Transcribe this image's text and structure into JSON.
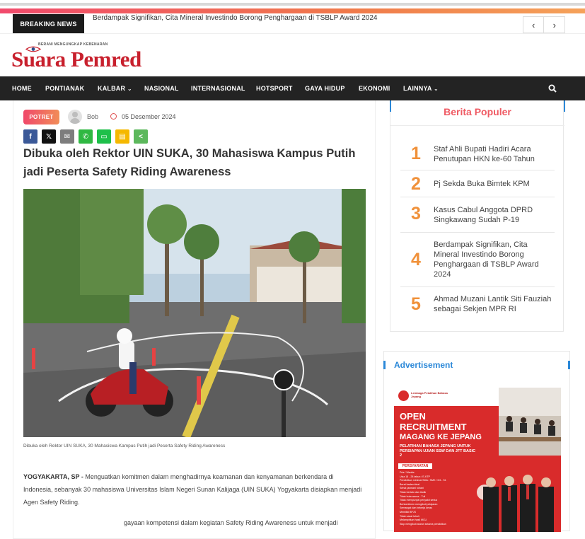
{
  "breaking": {
    "label": "BREAKING NEWS",
    "headline": "Berdampak Signifikan, Cita Mineral Investindo Borong Penghargaan di TSBLP Award 2024",
    "prev_icon": "chevron-left-icon",
    "next_icon": "chevron-right-icon"
  },
  "brand": {
    "tagline": "BERANI MENGUNGKAP KEBENARAN",
    "name": "Suara Pemred",
    "color": "#c8202d"
  },
  "nav": {
    "items": [
      "HOME",
      "PONTIANAK",
      "KALBAR",
      "NASIONAL",
      "INTERNASIONAL",
      "HOTSPORT",
      "GAYA HIDUP",
      "EKONOMI",
      "LAINNYA"
    ],
    "search_icon": "search-icon"
  },
  "article": {
    "category": "POTRET",
    "author": "Bob",
    "date": "05 Desember 2024",
    "title": "Dibuka oleh Rektor UIN SUKA, 30 Mahasiswa Kampus Putih jadi Peserta Safety Riding Awareness",
    "caption": "Dibuka oleh Rektor UIN SUKA, 30 Mahasiswa Kampus Putih jadi Peserta Safety Riding Awareness",
    "dateline": "YOGYAKARTA, SP -",
    "lead": "Menguatkan komitmen dalam menghadirnya keamanan dan kenyamanan berkendara di Indonesia, sebanyak 30 mahasiswa Universitas Islam Negeri Sunan Kalijaga (UIN SUKA) Yogyakarta disiapkan menjadi Agen Safety Riding.",
    "tail": "gayaan kompetensi dalam kegiatan Safety Riding Awareness untuk menjadi"
  },
  "share": [
    {
      "icon": "facebook-icon",
      "glyph": "f",
      "color": "#3b5998"
    },
    {
      "icon": "x-icon",
      "glyph": "𝕏",
      "color": "#111111"
    },
    {
      "icon": "email-icon",
      "glyph": "✉",
      "color": "#7d7d7d"
    },
    {
      "icon": "whatsapp-icon",
      "glyph": "✆",
      "color": "#2fb842"
    },
    {
      "icon": "line-icon",
      "glyph": "▭",
      "color": "#1ec04a"
    },
    {
      "icon": "sms-icon",
      "glyph": "▤",
      "color": "#f5b800"
    },
    {
      "icon": "share-icon",
      "glyph": "<",
      "color": "#5cb85c"
    }
  ],
  "popular": {
    "title": "Berita Populer",
    "items": [
      {
        "num": "1",
        "text": "Staf Ahli Bupati Hadiri Acara Penutupan HKN ke-60 Tahun"
      },
      {
        "num": "2",
        "text": "Pj Sekda Buka Bimtek KPM"
      },
      {
        "num": "3",
        "text": "Kasus Cabul Anggota DPRD Singkawang Sudah P-19"
      },
      {
        "num": "4",
        "text": "Berdampak Signifikan, Cita Mineral Investindo Borong Penghargaan di TSBLP Award 2024"
      },
      {
        "num": "5",
        "text": "Ahmad Muzani Lantik Siti Fauziah sebagai Sekjen MPR RI"
      }
    ]
  },
  "ads": {
    "title": "Advertisement",
    "org": "Lembaga Pelatihan Bahasa Jepang",
    "headline1": "OPEN",
    "headline2": "RECRUITMENT",
    "headline3": "MAGANG KE JEPANG",
    "sub": "PELATIHAN BAHASA JEPANG UNTUK PERSIAPAN UJIAN SSW DAN JFT BASIC 2",
    "req_label": "PERSYARATAN",
    "reqs": [
      "Pria / Wanita",
      "Usia 18 - 28 tahun / E-KTP",
      "Pendidikan minimal SMA / SMK / D3 - S1",
      "Berat badan ideal",
      "Sehat jasmani rohani",
      "Tidak bertato dan tindik",
      "Tidak buta warna - Tuli",
      "Tidak mempunyai penyakit serius",
      "Berkomitmen mengikuti pelajaran",
      "Semangat dan bekerja keras",
      "Memiliki BPJS",
      "Tidak cacat tubuh",
      "Melampirkan hasil MCU",
      "Siap mengikuti aturan selama pendidikan"
    ]
  }
}
